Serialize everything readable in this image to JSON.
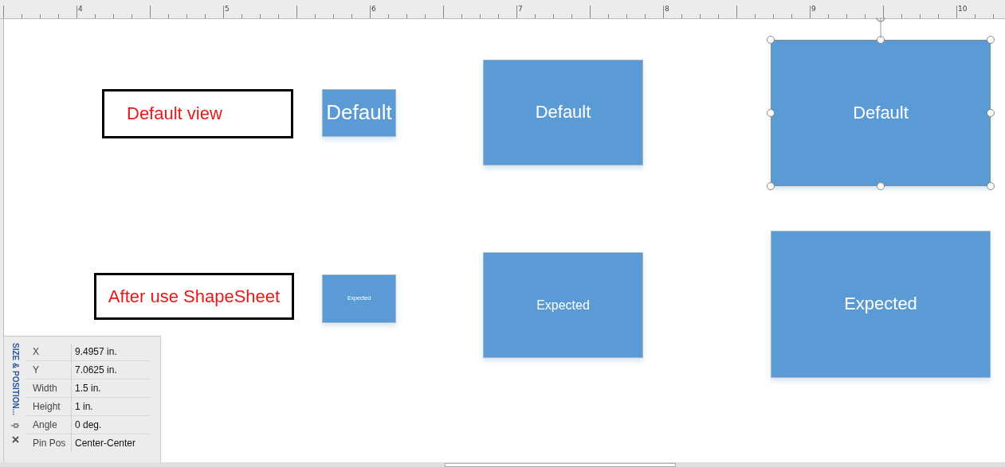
{
  "ruler": {
    "labels": [
      "4",
      "5",
      "6",
      "7",
      "8",
      "9",
      "10"
    ]
  },
  "shapes": [
    {
      "kind": "label",
      "text": "Default view"
    },
    {
      "kind": "label",
      "text": "After use ShapeSheet"
    },
    {
      "kind": "rect",
      "text": "Default",
      "selected": false
    },
    {
      "kind": "rect",
      "text": "Expected",
      "selected": false
    },
    {
      "kind": "rect",
      "text": "Default",
      "selected": false
    },
    {
      "kind": "rect",
      "text": "Expected",
      "selected": false
    },
    {
      "kind": "rect",
      "text": "Default",
      "selected": true
    },
    {
      "kind": "rect",
      "text": "Expected",
      "selected": false
    }
  ],
  "size_position": {
    "title": "SIZE & POSITION...",
    "rows": [
      {
        "label": "X",
        "value": "9.4957 in."
      },
      {
        "label": "Y",
        "value": "7.0625 in."
      },
      {
        "label": "Width",
        "value": "1.5 in."
      },
      {
        "label": "Height",
        "value": "1 in."
      },
      {
        "label": "Angle",
        "value": "0 deg."
      },
      {
        "label": "Pin Pos",
        "value": "Center-Center"
      }
    ]
  }
}
